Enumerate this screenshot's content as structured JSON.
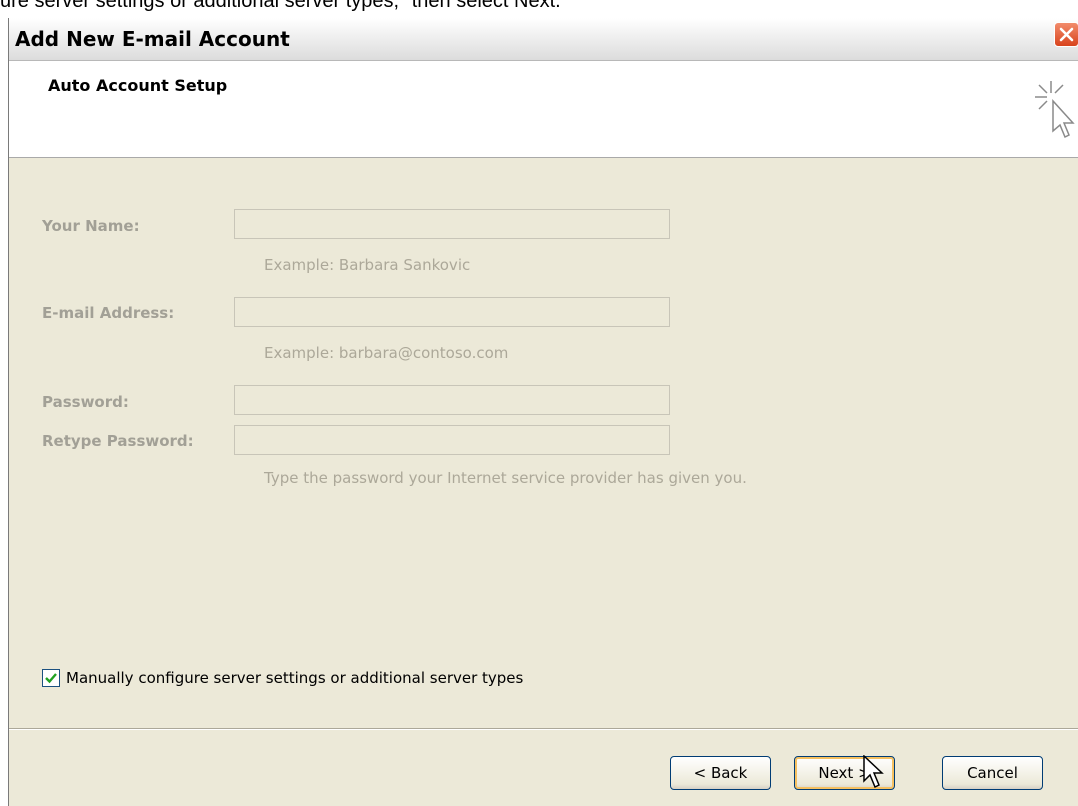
{
  "instruction": "ure server settings or additional server types,\" then select Next.",
  "window": {
    "title": "Add New E-mail Account"
  },
  "header": {
    "title": "Auto Account Setup"
  },
  "form": {
    "name_label": "Your Name:",
    "name_value": "",
    "name_example": "Example: Barbara Sankovic",
    "email_label": "E-mail Address:",
    "email_value": "",
    "email_example": "Example: barbara@contoso.com",
    "password_label": "Password:",
    "password_value": "",
    "retype_label": "Retype Password:",
    "retype_value": "",
    "password_hint": "Type the password your Internet service provider has given you."
  },
  "manual_config": {
    "label": "Manually configure server settings or additional server types",
    "checked": true
  },
  "buttons": {
    "back": "< Back",
    "next": "Next >",
    "cancel": "Cancel"
  },
  "colors": {
    "dialog_bg": "#ece9d8",
    "disabled_text": "#a2a096",
    "button_border": "#003c74",
    "close_button": "#d8431c"
  },
  "icons": {
    "close": "close-icon",
    "wizard": "wizard-cursor-icon",
    "check": "checkmark-icon",
    "cursor": "mouse-pointer-icon"
  }
}
